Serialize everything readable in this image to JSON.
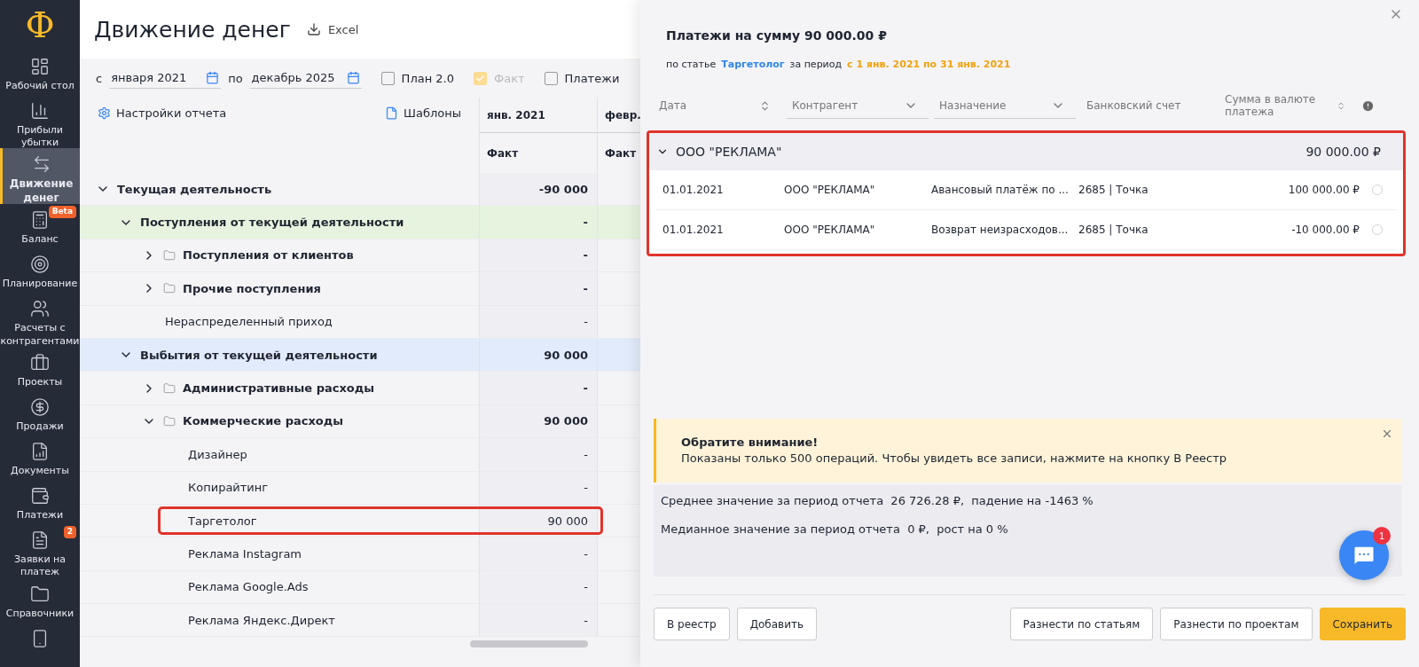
{
  "sidebar": {
    "logo": "Ф",
    "items": [
      {
        "label": "Рабочий стол",
        "selected": false
      },
      {
        "label": "Прибыли убытки",
        "selected": false
      },
      {
        "label": "Движение денег",
        "selected": true
      },
      {
        "label": "Баланс",
        "selected": false,
        "badge": "Beta"
      },
      {
        "label": "Планирование",
        "selected": false
      },
      {
        "label": "Расчеты с контрагентами",
        "selected": false
      },
      {
        "label": "Проекты",
        "selected": false
      },
      {
        "label": "Продажи",
        "selected": false
      },
      {
        "label": "Документы",
        "selected": false
      },
      {
        "label": "Платежи",
        "selected": false
      },
      {
        "label": "Заявки на платеж",
        "selected": false,
        "badge": "2"
      },
      {
        "label": "Справочники",
        "selected": false
      }
    ]
  },
  "header": {
    "title": "Движение денег",
    "export": "Excel"
  },
  "filters": {
    "from_label": "с",
    "from": "января 2021",
    "to_label": "по",
    "to": "декабрь 2025",
    "checkboxes": [
      {
        "label": "План 2.0",
        "checked": false,
        "disabled": false
      },
      {
        "label": "Факт",
        "checked": true,
        "disabled": true
      },
      {
        "label": "Платежи",
        "checked": false,
        "disabled": false
      }
    ]
  },
  "report": {
    "settings": "Настройки отчета",
    "templates": "Шаблоны",
    "columns": [
      {
        "month": "янв. 2021",
        "sub": "Факт"
      },
      {
        "month": "февр.",
        "sub": "Факт"
      }
    ],
    "rows": [
      {
        "label": "Текущая деятельность",
        "value": "-90 000",
        "expanded": true,
        "bold": true,
        "children": [
          {
            "label": "Поступления от текущей деятельности",
            "value": "-",
            "expanded": true,
            "bold": true,
            "color": "#e6f4df",
            "children": [
              {
                "label": "Поступления от клиентов",
                "value": "-",
                "expanded": false,
                "folder": true,
                "bold": true
              },
              {
                "label": "Прочие поступления",
                "value": "-",
                "expanded": false,
                "folder": true,
                "bold": true
              },
              {
                "label": "Нераспределенный приход",
                "value": "-"
              }
            ]
          },
          {
            "label": "Выбытия от текущей деятельности",
            "value": "90 000",
            "expanded": true,
            "bold": true,
            "color": "#e1ebfb",
            "children": [
              {
                "label": "Административные расходы",
                "value": "-",
                "expanded": false,
                "folder": true,
                "bold": true
              },
              {
                "label": "Коммерческие расходы",
                "value": "90 000",
                "expanded": true,
                "folder": true,
                "bold": true,
                "children": [
                  {
                    "label": "Дизайнер",
                    "value": "-"
                  },
                  {
                    "label": "Копирайтинг",
                    "value": "-"
                  },
                  {
                    "label": "Таргетолог",
                    "value": "90 000",
                    "highlighted": true
                  },
                  {
                    "label": "Реклама Instagram",
                    "value": "-"
                  },
                  {
                    "label": "Реклама Google.Ads",
                    "value": "-"
                  },
                  {
                    "label": "Реклама Яндекс.Директ",
                    "value": "-"
                  }
                ]
              }
            ]
          }
        ]
      }
    ]
  },
  "drawer": {
    "title": "Платежи на сумму 90 000.00 ₽",
    "by_article": "по статье",
    "article": "Таргетолог",
    "for_period": "за период",
    "period": "с 1 янв. 2021 по 31 янв. 2021",
    "columns": [
      {
        "label": "Дата",
        "kind": "sort"
      },
      {
        "label": "Контрагент",
        "kind": "select"
      },
      {
        "label": "Назначение",
        "kind": "select"
      },
      {
        "label": "Банковский счет",
        "kind": "plain"
      },
      {
        "label": "Сумма в валюте платежа",
        "kind": "sort"
      }
    ],
    "groups": [
      {
        "name": "ООО \"РЕКЛАМА\"",
        "total": "90 000.00 ₽",
        "expanded": true,
        "highlighted": true,
        "rows": [
          {
            "date": "01.01.2021",
            "counterparty": "ООО \"РЕКЛАМА\"",
            "purpose": "Авансовый платёж по ...",
            "account": "2685 | Точка",
            "amount": "100 000.00 ₽",
            "selected": false
          },
          {
            "date": "01.01.2021",
            "counterparty": "ООО \"РЕКЛАМА\"",
            "purpose": "Возврат неизрасходов...",
            "account": "2685 | Точка",
            "amount": "-10 000.00 ₽",
            "selected": false
          }
        ]
      }
    ],
    "alert": {
      "title": "Обратите внимание!",
      "text": "Показаны только 500 операций. Чтобы увидеть все записи, нажмите на кнопку В Реестр"
    },
    "stats": [
      "Среднее значение за период отчета  26 726.28 ₽,  падение на -1463 %",
      "Медианное значение за период отчета  0 ₽,  рост на 0 %"
    ],
    "buttons_left": [
      {
        "label": "В реестр",
        "kind": "secondary"
      },
      {
        "label": "Добавить",
        "kind": "secondary"
      }
    ],
    "buttons_right": [
      {
        "label": "Разнести по статьям",
        "kind": "secondary"
      },
      {
        "label": "Разнести по проектам",
        "kind": "secondary"
      },
      {
        "label": "Сохранить",
        "kind": "primary"
      }
    ]
  },
  "chat": {
    "badge": "1"
  }
}
